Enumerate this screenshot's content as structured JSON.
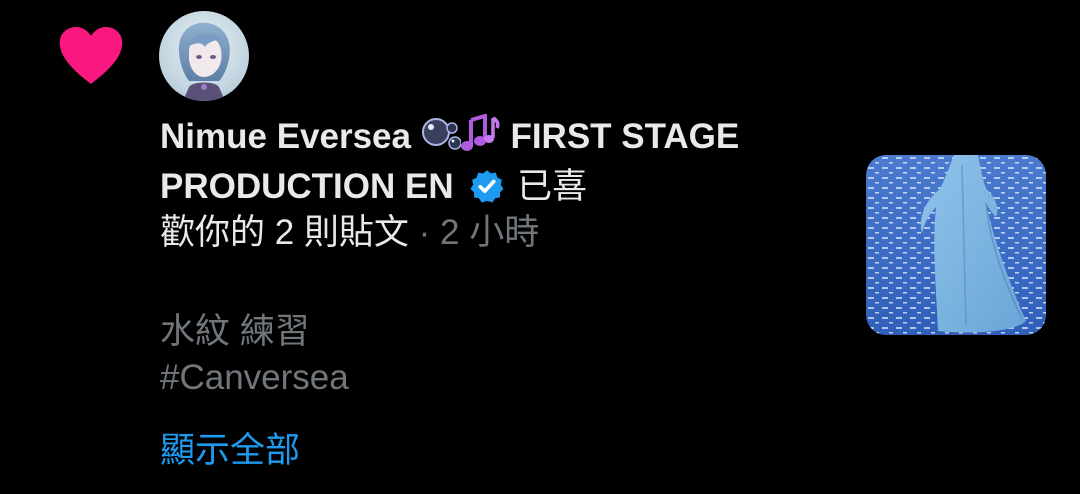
{
  "notification": {
    "type_icon": "heart-icon",
    "author_name": "Nimue Eversea",
    "author_emoji": [
      "bubbles-icon",
      "music-notes-icon"
    ],
    "author_suffix": "FIRST STAGE PRODUCTION EN",
    "verified": true,
    "action_text_1": "已喜",
    "action_text_2": "歡你的 2 則貼文",
    "separator": "·",
    "timestamp": "2 小時",
    "tweet_line_1": "水紋 練習",
    "tweet_line_2": "#Canversea",
    "show_more": "顯示全部"
  },
  "colors": {
    "background": "#000000",
    "primary_text": "#E7E9EA",
    "secondary_text": "#71767B",
    "link": "#1D9BF0",
    "heart": "#F91880",
    "verified_badge": "#1D9BF0"
  }
}
